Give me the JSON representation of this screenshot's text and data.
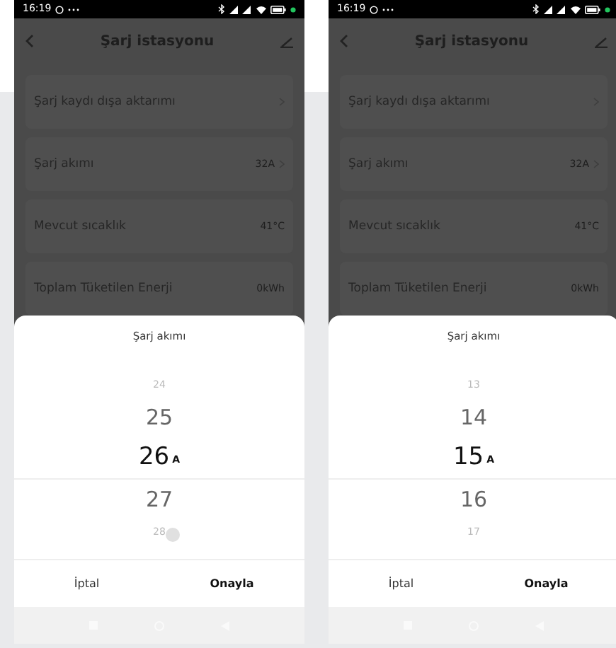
{
  "phones": [
    {
      "status_time": "16:19",
      "title": "Şarj istasyonu",
      "rows": [
        {
          "label": "Şarj kaydı dışa aktarımı",
          "value": "",
          "chevron": true
        },
        {
          "label": "Şarj akımı",
          "value": "32A",
          "chevron": true
        },
        {
          "label": "Mevcut sıcaklık",
          "value": "41°C",
          "chevron": false
        },
        {
          "label": "Toplam Tüketilen Enerji",
          "value": "0kWh",
          "chevron": false
        }
      ],
      "sheet": {
        "title": "Şarj akımı",
        "unit": "A",
        "touch_marker": true,
        "options": [
          {
            "text": "24",
            "selected": false
          },
          {
            "text": "25",
            "selected": false
          },
          {
            "text": "26",
            "selected": true
          },
          {
            "text": "27",
            "selected": false
          },
          {
            "text": "28",
            "selected": false
          }
        ],
        "cancel": "İptal",
        "confirm": "Onayla"
      }
    },
    {
      "status_time": "16:19",
      "title": "Şarj istasyonu",
      "rows": [
        {
          "label": "Şarj kaydı dışa aktarımı",
          "value": "",
          "chevron": true
        },
        {
          "label": "Şarj akımı",
          "value": "32A",
          "chevron": true
        },
        {
          "label": "Mevcut sıcaklık",
          "value": "41°C",
          "chevron": false
        },
        {
          "label": "Toplam Tüketilen Enerji",
          "value": "0kWh",
          "chevron": false
        }
      ],
      "sheet": {
        "title": "Şarj akımı",
        "unit": "A",
        "touch_marker": false,
        "options": [
          {
            "text": "13",
            "selected": false
          },
          {
            "text": "14",
            "selected": false
          },
          {
            "text": "15",
            "selected": true
          },
          {
            "text": "16",
            "selected": false
          },
          {
            "text": "17",
            "selected": false
          }
        ],
        "cancel": "İptal",
        "confirm": "Onayla"
      }
    }
  ]
}
